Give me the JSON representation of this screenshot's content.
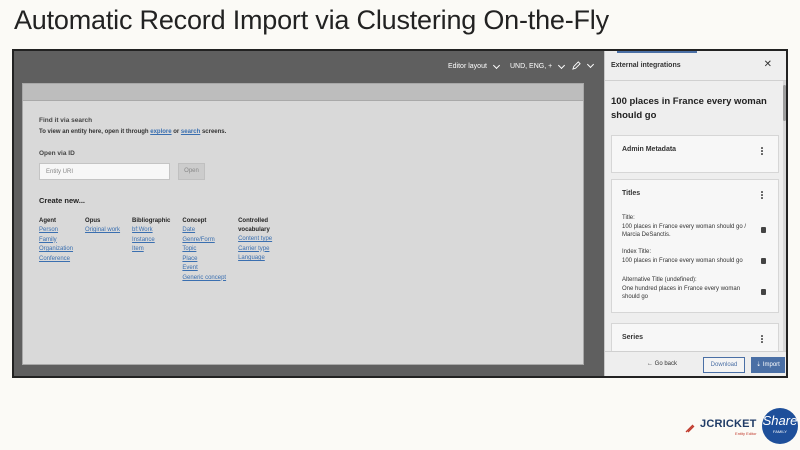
{
  "slide": {
    "title": "Automatic Record Import via Clustering On-the-Fly"
  },
  "topbar": {
    "layout_label": "Editor layout",
    "lang_label": "UND, ENG, +"
  },
  "editor": {
    "find_heading": "Find it via search",
    "find_prefix": "To view an entity here, open it through ",
    "find_link1": "explore",
    "find_mid": " or ",
    "find_link2": "search",
    "find_suffix": " screens.",
    "open_via_id": "Open via ID",
    "uri_placeholder": "Entity URI",
    "open_button": "Open",
    "create_new": "Create new...",
    "columns": [
      {
        "head": "Agent",
        "items": [
          "Person",
          "Family",
          "Organization",
          "Conference"
        ]
      },
      {
        "head": "Opus",
        "items": [
          "Original work"
        ]
      },
      {
        "head": "Bibliographic",
        "items": [
          "bf:Work",
          "Instance",
          "Item"
        ]
      },
      {
        "head": "Concept",
        "items": [
          "Date",
          "Genre/Form",
          "Topic",
          "Place",
          "Event",
          "Generic concept"
        ]
      },
      {
        "head": "Controlled vocabulary",
        "items": [
          "Content type",
          "Carrier type",
          "Language"
        ]
      }
    ]
  },
  "panel": {
    "title": "External integrations",
    "record_title": "100 places in France every woman should go",
    "admin_card": "Admin Metadata",
    "titles_card": "Titles",
    "title_field_label": "Title:",
    "title_field_value": "100 places in France every woman should go / Marcia DeSanctis.",
    "index_field_label": "Index Title:",
    "index_field_value": "100 places in France every woman should go",
    "alt_field_label": "Alternative Title (undefined):",
    "alt_field_value": "One hundred places in France every woman should go",
    "series_card": "Series",
    "go_back": "Go back",
    "download": "Download",
    "import": "Import"
  },
  "branding": {
    "logo": "JCRICKET",
    "logo_sub": "Entity Editor",
    "share": "Share",
    "share_sub": "FAMILY"
  },
  "colors": {
    "accent": "#4a6fa5",
    "link": "#3a6fb0",
    "dark_chrome": "#5f5f5f"
  }
}
